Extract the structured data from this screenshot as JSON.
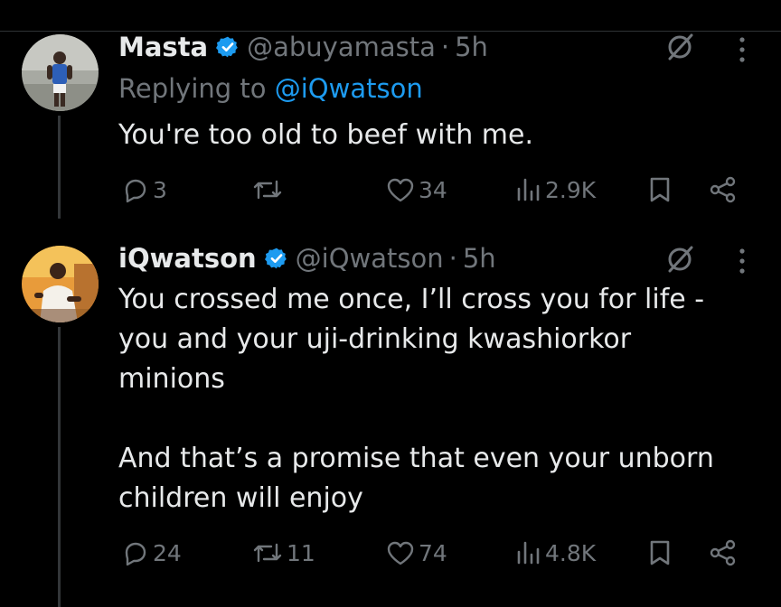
{
  "tweets": [
    {
      "name": "Masta",
      "handle": "@abuyamasta",
      "separator": "·",
      "time": "5h",
      "replying_prefix": "Replying to",
      "replying_to": "@iQwatson",
      "text": "You're too old to beef with me.",
      "metrics": {
        "replies": "3",
        "reposts": "",
        "likes": "34",
        "views": "2.9K"
      }
    },
    {
      "name": "iQwatson",
      "handle": "@iQwatson",
      "separator": "·",
      "time": "5h",
      "text": "You crossed me once, I’ll cross you for life -\nyou and your uji-drinking kwashiorkor\nminions\n\nAnd that’s a promise that even your unborn\nchildren will enjoy",
      "metrics": {
        "replies": "24",
        "reposts": "11",
        "likes": "74",
        "views": "4.8K"
      }
    }
  ],
  "icons": [
    "verified-badge-icon",
    "grok-icon",
    "more-icon",
    "reply-icon",
    "repost-icon",
    "like-icon",
    "views-icon",
    "bookmark-icon",
    "share-icon"
  ],
  "colors": {
    "background": "#000000",
    "text": "#e7e9ea",
    "muted": "#71767b",
    "accent": "#1d9bf0"
  }
}
